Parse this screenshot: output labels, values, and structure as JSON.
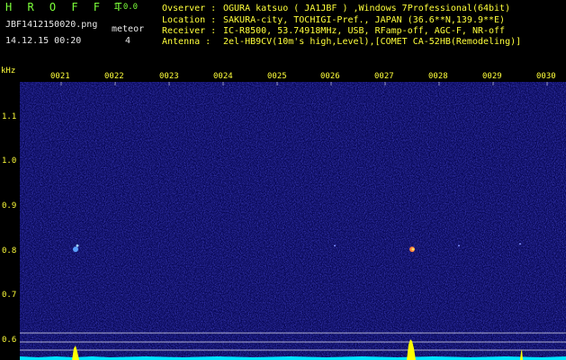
{
  "header": {
    "app_title": "H R O F F T",
    "version": "1.0.0",
    "filename": "JBF1412150020.png",
    "timestamp": "14.12.15 00:20",
    "meteor_label": "meteor",
    "meteor_count": "4"
  },
  "station_info": [
    {
      "label": "Ovserver :",
      "value": "OGURA katsuo ( JA1JBF ) ,Windows 7Professional(64bit)"
    },
    {
      "label": "Location :",
      "value": "SAKURA-city, TOCHIGI-Pref., JAPAN (36.6**N,139.9**E)"
    },
    {
      "label": "Receiver :",
      "value": "IC-R8500, 53.74918MHz, USB, RFamp-off, AGC-F, NR-off"
    },
    {
      "label": "Antenna  :",
      "value": "2el-HB9CV(10m's high,Level),[COMET CA-52HB(Remodeling)]"
    }
  ],
  "axes": {
    "y_unit": "kHz",
    "y_ticks": [
      "1.1",
      "1.0",
      "0.9",
      "0.8",
      "0.7",
      "0.6"
    ],
    "x_ticks": [
      "0021",
      "0022",
      "0023",
      "0024",
      "0025",
      "0026",
      "0027",
      "0028",
      "0029",
      "0030"
    ]
  },
  "colors": {
    "background": "#000000",
    "spectrogram_base": "#0a0a60",
    "header_text": "#7cff3a",
    "info_text": "#e8e8e8",
    "tick_text": "#ffff3a",
    "signal_trace": "#ffff00",
    "noise_trace": "#00ffff"
  }
}
